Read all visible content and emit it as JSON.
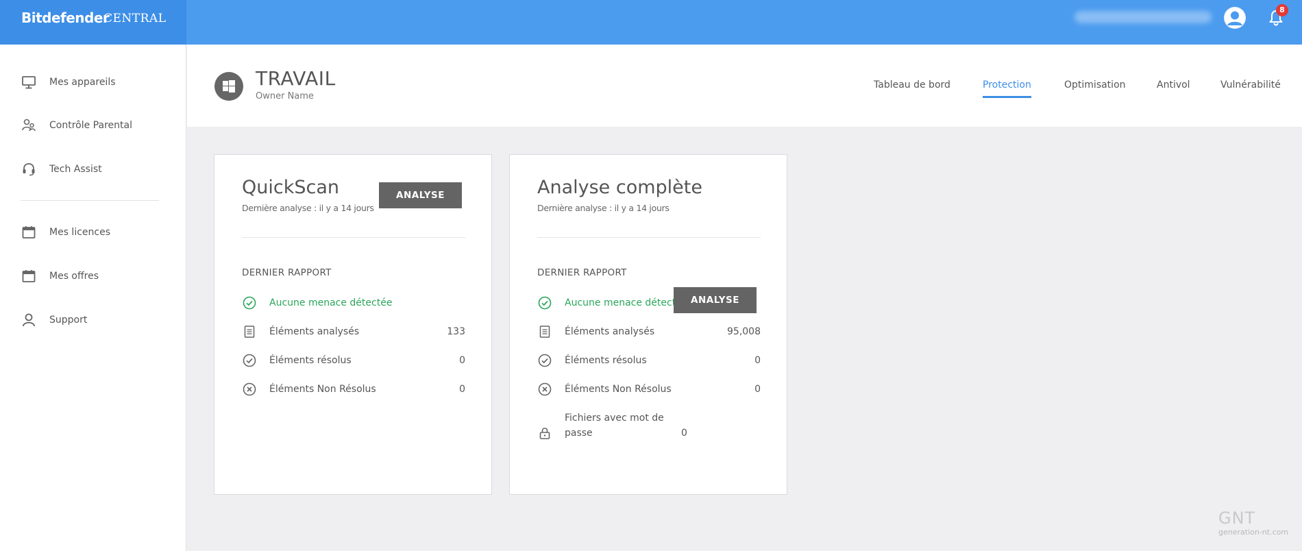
{
  "header": {
    "brand_name": "Bitdefender",
    "brand_sub": "CENTRAL",
    "notification_count": "8",
    "colors": {
      "topbar": "#4b9bef",
      "brand_bg": "#3d8ee6",
      "accent": "#3c8fe6",
      "success": "#2aa65a"
    }
  },
  "sidebar": {
    "items": [
      {
        "label": "Mes appareils",
        "icon": "monitor-icon"
      },
      {
        "label": "Contrôle Parental",
        "icon": "parental-icon"
      },
      {
        "label": "Tech Assist",
        "icon": "headset-icon"
      },
      {
        "label": "Mes licences",
        "icon": "calendar-icon"
      },
      {
        "label": "Mes offres",
        "icon": "calendar-icon"
      },
      {
        "label": "Support",
        "icon": "person-icon"
      }
    ]
  },
  "device": {
    "name": "TRAVAIL",
    "owner": "Owner Name",
    "os_icon": "windows-icon"
  },
  "tabs": [
    {
      "label": "Tableau de bord",
      "active": false
    },
    {
      "label": "Protection",
      "active": true
    },
    {
      "label": "Optimisation",
      "active": false
    },
    {
      "label": "Antivol",
      "active": false
    },
    {
      "label": "Vulnérabilité",
      "active": false
    }
  ],
  "cards": {
    "quickscan": {
      "title": "QuickScan",
      "subtitle": "Dernière analyse : il y a 14 jours",
      "button": "ANALYSE",
      "report_title": "DERNIER RAPPORT",
      "status": "Aucune menace détectée",
      "rows": [
        {
          "label": "Éléments analysés",
          "value": "133"
        },
        {
          "label": "Éléments résolus",
          "value": "0"
        },
        {
          "label": "Éléments Non Résolus",
          "value": "0"
        }
      ]
    },
    "full": {
      "title": "Analyse complète",
      "subtitle": "Dernière analyse : il y a 14 jours",
      "button": "ANALYSE",
      "report_title": "DERNIER RAPPORT",
      "status": "Aucune menace détectée",
      "rows": [
        {
          "label": "Éléments analysés",
          "value": "95,008"
        },
        {
          "label": "Éléments résolus",
          "value": "0"
        },
        {
          "label": "Éléments Non Résolus",
          "value": "0"
        },
        {
          "label": "Fichiers avec mot de passe",
          "value": "0"
        }
      ]
    }
  },
  "watermark": {
    "text": "GNT",
    "sub": "generation-nt.com"
  }
}
